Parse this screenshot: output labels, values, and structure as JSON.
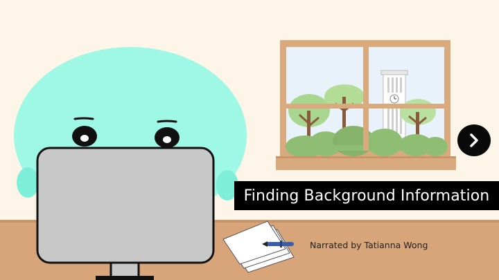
{
  "slide": {
    "title": "Finding Background Information",
    "narrator": "Narrated by Tatianna Wong"
  },
  "controls": {
    "next_icon": "chevron-right-icon"
  },
  "colors": {
    "background": "#fdf6e8",
    "desk": "#d8a47a",
    "character": "#9ff7e6",
    "monitor": "#c8c8c8",
    "window_frame": "#d9aa7d",
    "sky": "#e9f2fb",
    "banner": "#000000"
  }
}
